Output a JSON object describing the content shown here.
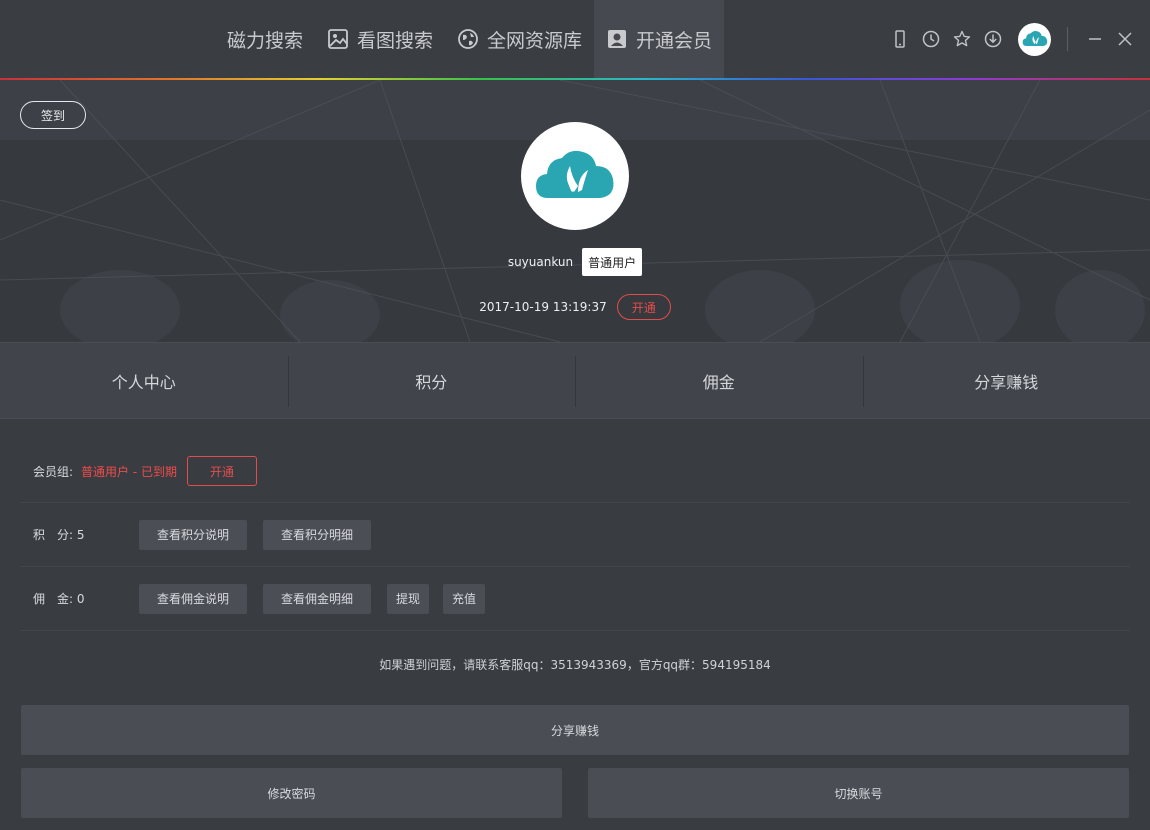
{
  "nav": {
    "items": [
      {
        "label": "磁力搜索",
        "icon": "none"
      },
      {
        "label": "看图搜索",
        "icon": "image-icon"
      },
      {
        "label": "全网资源库",
        "icon": "globe-icon"
      },
      {
        "label": "开通会员",
        "icon": "user-card-icon",
        "active": true
      }
    ]
  },
  "window_controls": {
    "icons": [
      "mobile-icon",
      "clock-icon",
      "star-icon",
      "download-icon",
      "avatar",
      "minimize-icon",
      "close-icon"
    ]
  },
  "profile": {
    "signin_label": "签到",
    "username": "suyuankun",
    "user_level": "普通用户",
    "expiry_date": "2017-10-19 13:19:37",
    "open_label": "开通"
  },
  "tabs": [
    {
      "label": "个人中心"
    },
    {
      "label": "积分"
    },
    {
      "label": "佣金"
    },
    {
      "label": "分享赚钱"
    }
  ],
  "info": {
    "member_label": "会员组:",
    "member_status": "普通用户 - 已到期",
    "member_open": "开通",
    "points_label": "积　分:",
    "points_value": "5",
    "points_btn_rule": "查看积分说明",
    "points_btn_detail": "查看积分明细",
    "commission_label": "佣　金:",
    "commission_value": "0",
    "commission_btn_rule": "查看佣金说明",
    "commission_btn_detail": "查看佣金明细",
    "withdraw": "提现",
    "recharge": "充值"
  },
  "contact": "如果遇到问题，请联系客服qq：3513943369，官方qq群：594195184",
  "bottom": {
    "share": "分享赚钱",
    "change_password": "修改密码",
    "switch_account": "切换账号"
  },
  "colors": {
    "accent_red": "#ef4b4b",
    "brand_teal": "#2aa6b3",
    "background": "#393c41"
  }
}
